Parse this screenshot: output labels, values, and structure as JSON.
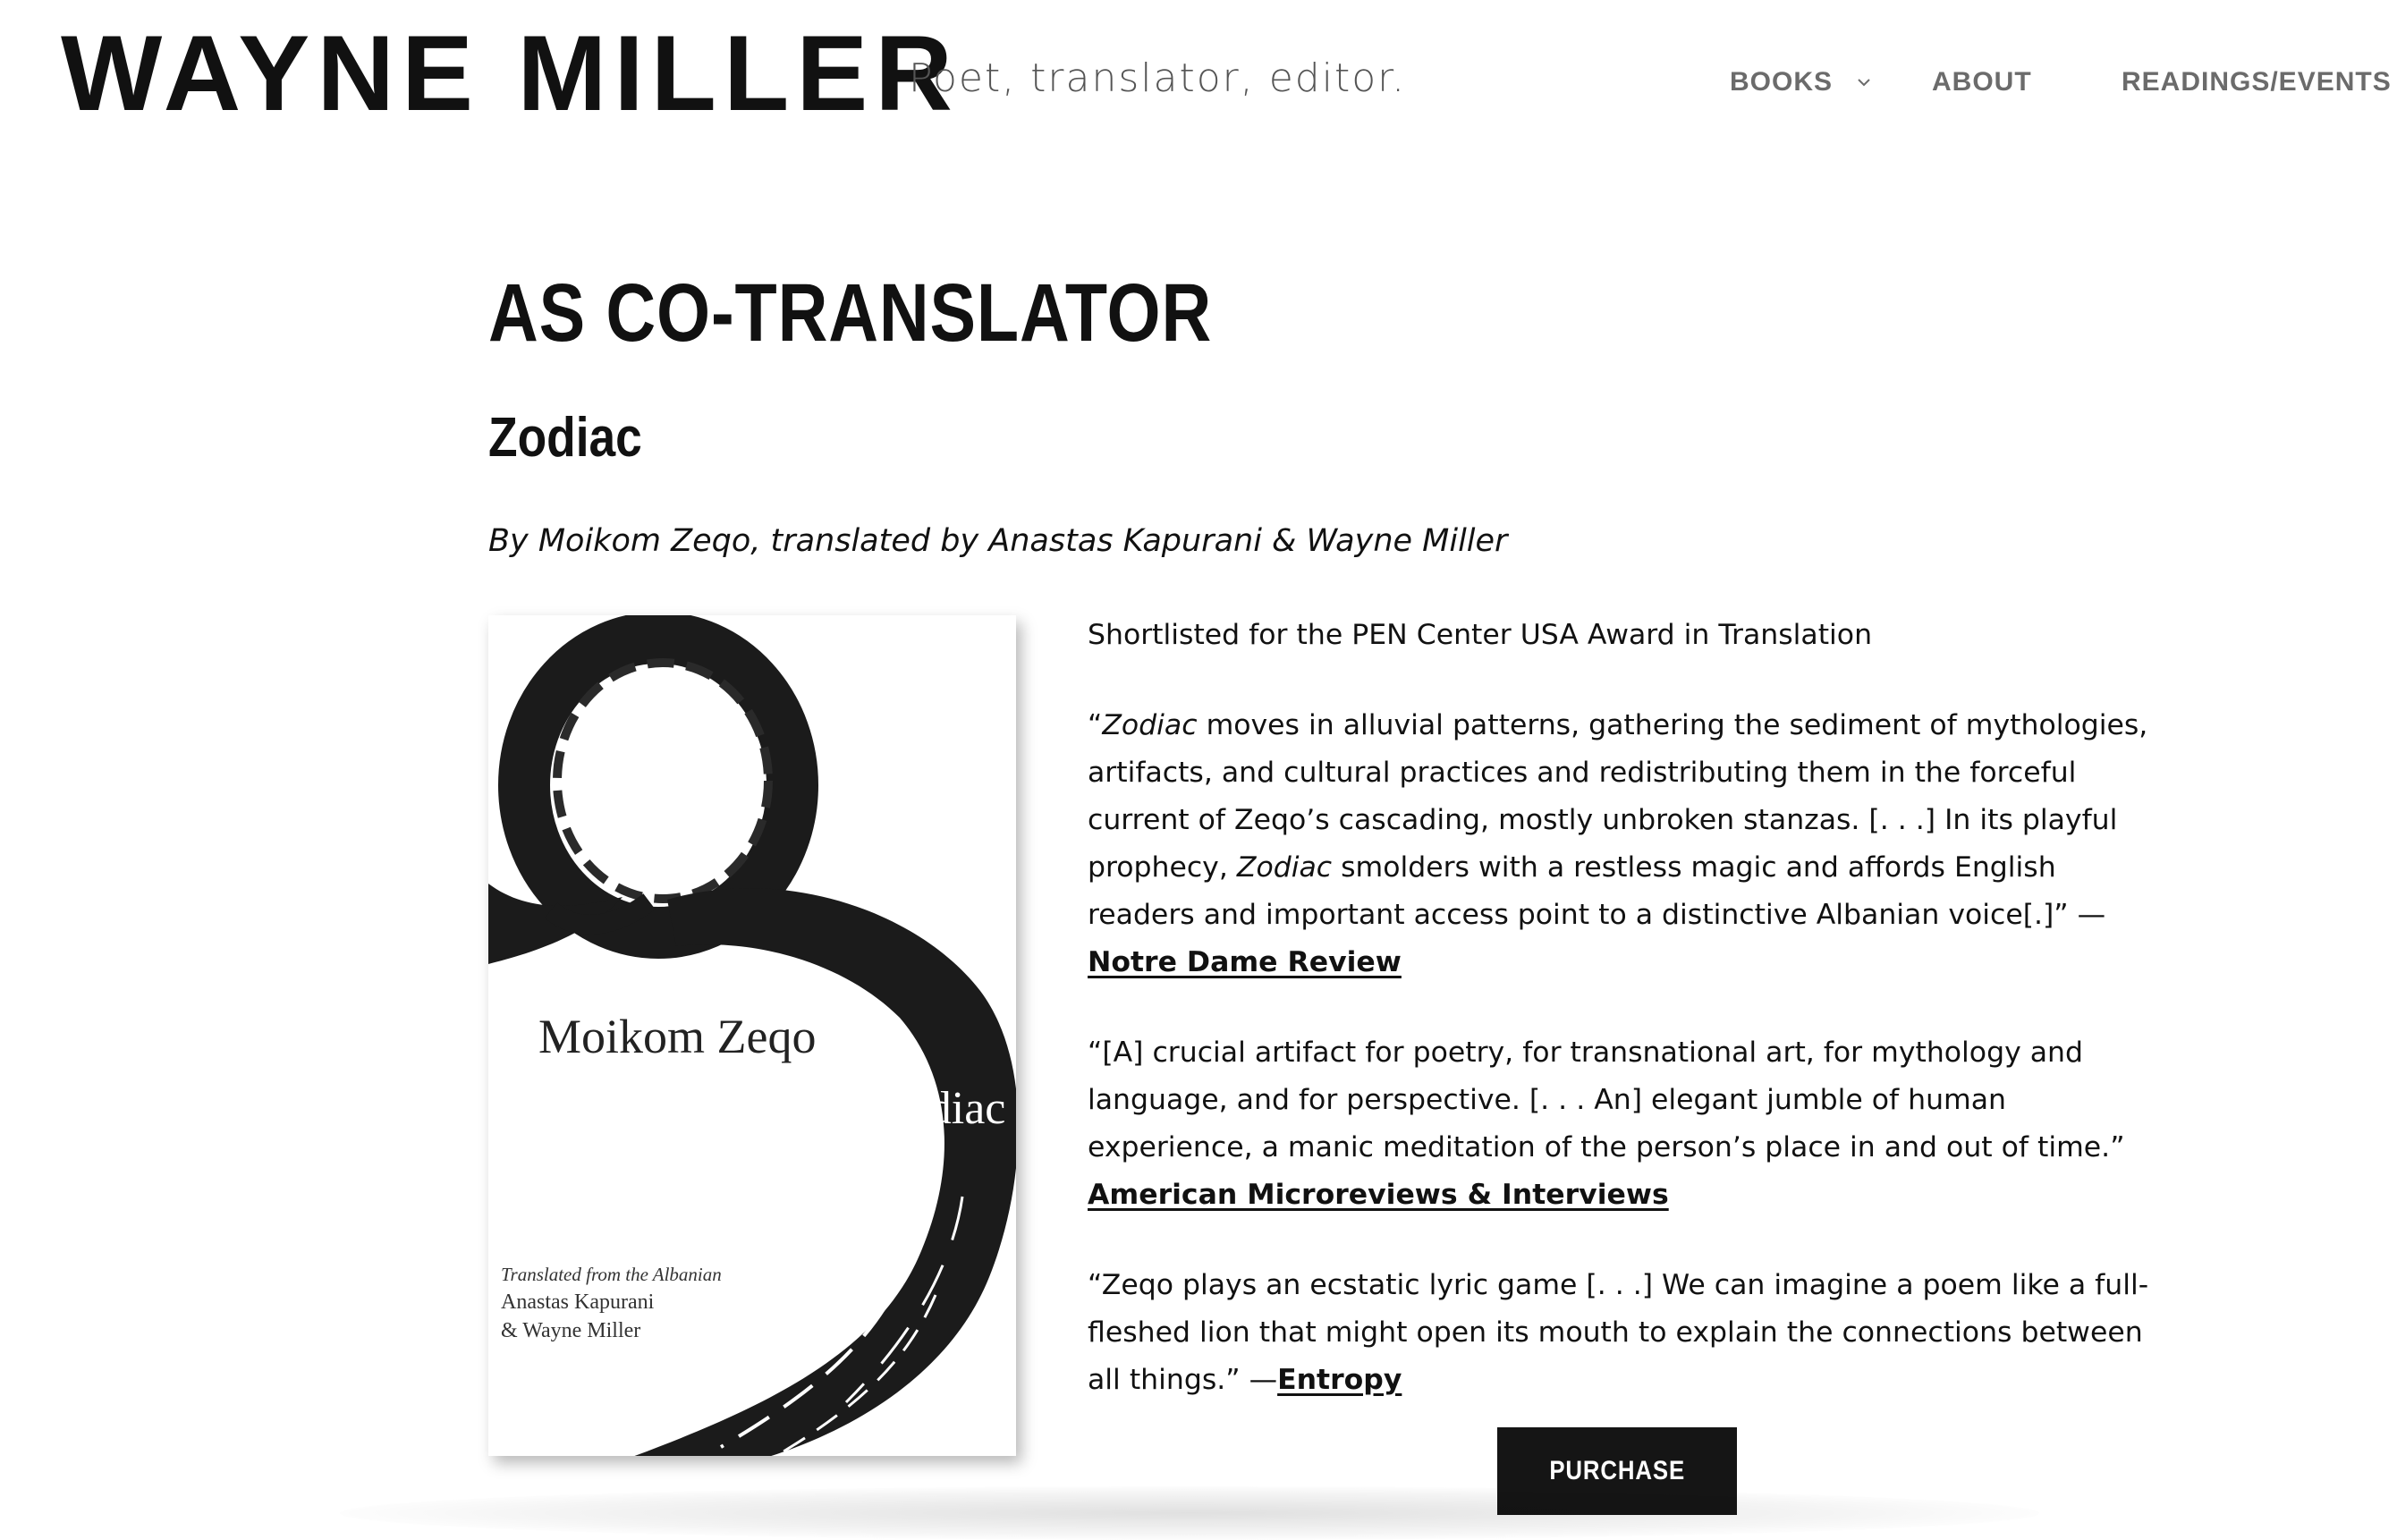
{
  "header": {
    "site_title": "WAYNE MILLER",
    "tagline": "Poet, translator, editor.",
    "nav": {
      "books": "BOOKS",
      "about": "ABOUT",
      "readings": "READINGS/EVENTS"
    }
  },
  "main": {
    "section_title": "AS CO-TRANSLATOR",
    "book": {
      "title": "Zodiac",
      "byline": "By Moikom Zeqo, translated by Anastas Kapurani & Wayne Miller",
      "cover": {
        "author": "Moikom Zeqo",
        "title": "Zodiac",
        "credit_line1": "Translated from the Albanian",
        "credit_line2": "Anastas Kapurani",
        "credit_line3": "& Wayne Miller"
      },
      "award": "Shortlisted for the PEN Center USA Award in Translation",
      "review1": {
        "q1": "“",
        "em1": "Zodiac",
        "q2": " moves in alluvial patterns, gathering the sediment of mythologies, artifacts, and cultural practices and redistributing them in the forceful current of Zeqo’s cascading, mostly unbroken stanzas. [. . .] In its playful prophecy, ",
        "em2": "Zodiac",
        "q3": " smolders with a restless magic and affords English readers and important access point to a distinctive Albanian voice[.]” —",
        "source": "Notre Dame Review"
      },
      "review2": {
        "quote": "“[A] crucial artifact for poetry, for transnational art, for mythology and language, and for perspective. [. . . An] elegant jumble of human experience, a manic meditation of the person’s place in and out of time.” ",
        "source": "American Microreviews & Interviews"
      },
      "review3": {
        "quote": "“Zeqo plays an ecstatic lyric game [. . .] We can imagine a poem like a full-fleshed lion that might open its mouth to explain the connections between all things.” —",
        "source": "Entropy"
      },
      "purchase_label": "PURCHASE"
    }
  }
}
